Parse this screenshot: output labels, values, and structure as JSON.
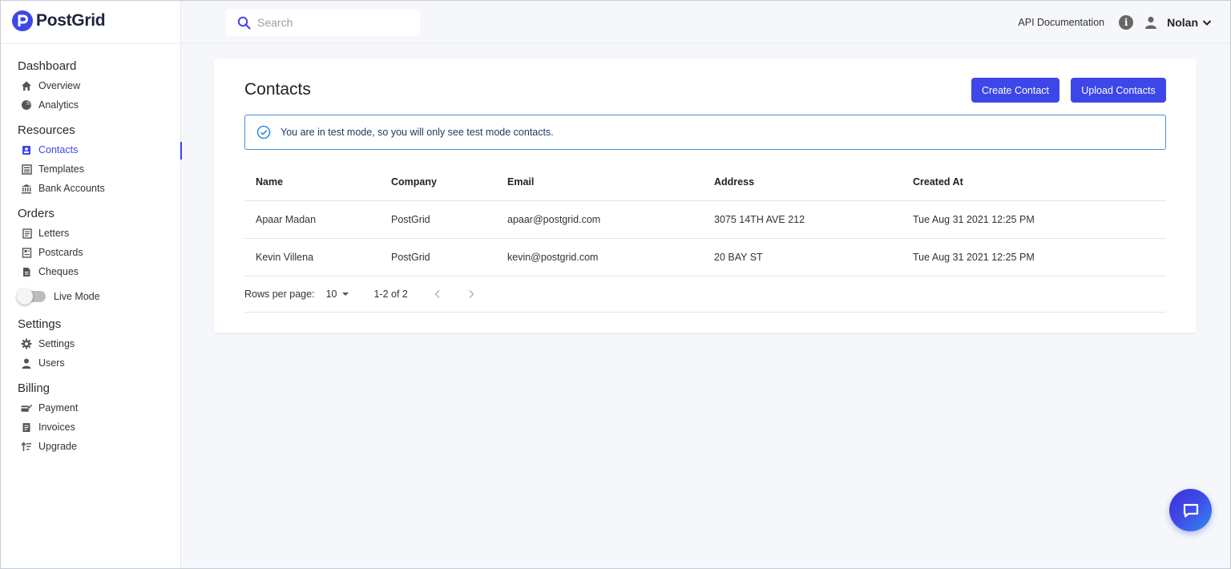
{
  "brand": {
    "name": "PostGrid",
    "accent": "#3d47e8"
  },
  "sidebar": {
    "sections": [
      {
        "title": "Dashboard",
        "items": [
          {
            "label": "Overview",
            "icon": "home-icon"
          },
          {
            "label": "Analytics",
            "icon": "pie-chart-icon"
          }
        ]
      },
      {
        "title": "Resources",
        "items": [
          {
            "label": "Contacts",
            "icon": "contact-card-icon",
            "active": true
          },
          {
            "label": "Templates",
            "icon": "template-icon"
          },
          {
            "label": "Bank Accounts",
            "icon": "bank-icon"
          }
        ]
      },
      {
        "title": "Orders",
        "items": [
          {
            "label": "Letters",
            "icon": "letter-icon"
          },
          {
            "label": "Postcards",
            "icon": "postcard-icon"
          },
          {
            "label": "Cheques",
            "icon": "cheque-icon"
          }
        ]
      },
      {
        "title": "Settings",
        "items": [
          {
            "label": "Settings",
            "icon": "gear-icon"
          },
          {
            "label": "Users",
            "icon": "user-icon"
          }
        ]
      },
      {
        "title": "Billing",
        "items": [
          {
            "label": "Payment",
            "icon": "payment-icon"
          },
          {
            "label": "Invoices",
            "icon": "invoice-icon"
          },
          {
            "label": "Upgrade",
            "icon": "upgrade-icon"
          }
        ]
      }
    ],
    "live_mode": {
      "label": "Live Mode",
      "on": false
    }
  },
  "topbar": {
    "search_placeholder": "Search",
    "api_doc": "API Documentation",
    "user_name": "Nolan"
  },
  "main": {
    "title": "Contacts",
    "create_button": "Create Contact",
    "upload_button": "Upload Contacts",
    "alert": "You are in test mode, so you will only see test mode contacts.",
    "table": {
      "columns": [
        "Name",
        "Company",
        "Email",
        "Address",
        "Created At"
      ],
      "rows": [
        [
          "Apaar Madan",
          "PostGrid",
          "apaar@postgrid.com",
          "3075 14TH AVE 212",
          "Tue Aug 31 2021 12:25 PM"
        ],
        [
          "Kevin Villena",
          "PostGrid",
          "kevin@postgrid.com",
          "20 BAY ST",
          "Tue Aug 31 2021 12:25 PM"
        ]
      ]
    },
    "pagination": {
      "rows_per_page_label": "Rows per page:",
      "rows_per_page": "10",
      "range": "1-2 of 2"
    }
  }
}
